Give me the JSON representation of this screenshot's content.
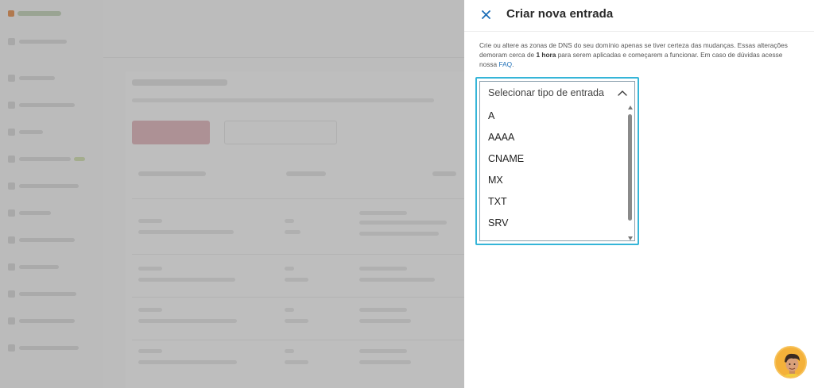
{
  "drawer": {
    "title": "Criar nova entrada",
    "info_part1": "Crie ou altere as zonas de DNS do seu domínio apenas se tiver certeza das mudanças. Essas alterações demoram cerca de ",
    "info_bold": "1 hora",
    "info_part2": " para serem aplicadas e começarem a funcionar. Em caso de dúvidas acesse nossa ",
    "info_link": "FAQ",
    "info_end": "."
  },
  "select": {
    "placeholder": "Selecionar tipo de entrada",
    "options": [
      "A",
      "AAAA",
      "CNAME",
      "MX",
      "TXT",
      "SRV"
    ]
  },
  "icons": {
    "close": "close-icon",
    "chevron": "chevron-up-icon",
    "avatar": "support-avatar"
  },
  "colors": {
    "accent": "#1e6fb8",
    "focus_ring": "#35b5d8",
    "avatar_bg": "#f4b13a"
  }
}
